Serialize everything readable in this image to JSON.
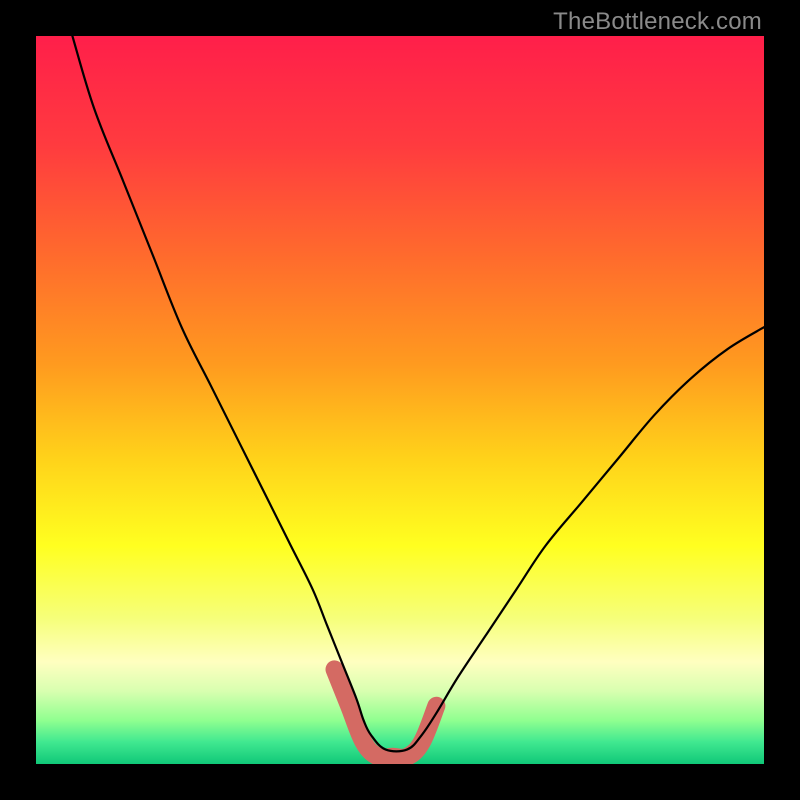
{
  "watermark": "TheBottleneck.com",
  "chart_data": {
    "type": "line",
    "title": "",
    "xlabel": "",
    "ylabel": "",
    "xlim": [
      0,
      100
    ],
    "ylim": [
      0,
      100
    ],
    "series": [
      {
        "name": "bottleneck-curve",
        "x": [
          5,
          8,
          12,
          16,
          20,
          24,
          28,
          32,
          35,
          38,
          40,
          42,
          44,
          45,
          46,
          48,
          51,
          53,
          55,
          58,
          62,
          66,
          70,
          75,
          80,
          85,
          90,
          95,
          100
        ],
        "y": [
          100,
          90,
          80,
          70,
          60,
          52,
          44,
          36,
          30,
          24,
          19,
          14,
          9,
          6,
          4,
          2,
          2,
          4,
          7,
          12,
          18,
          24,
          30,
          36,
          42,
          48,
          53,
          57,
          60
        ]
      },
      {
        "name": "highlight-band",
        "x": [
          41,
          43,
          45,
          47,
          49,
          51,
          53,
          55
        ],
        "y": [
          13,
          8,
          3,
          1,
          1,
          1,
          3,
          8
        ]
      }
    ],
    "gradient_stops": [
      {
        "pos": 0.0,
        "color": "#ff1f4a"
      },
      {
        "pos": 0.15,
        "color": "#ff3b3f"
      },
      {
        "pos": 0.3,
        "color": "#ff6a2d"
      },
      {
        "pos": 0.45,
        "color": "#ff9a1f"
      },
      {
        "pos": 0.58,
        "color": "#ffd21a"
      },
      {
        "pos": 0.7,
        "color": "#ffff20"
      },
      {
        "pos": 0.8,
        "color": "#f6ff7a"
      },
      {
        "pos": 0.86,
        "color": "#ffffc0"
      },
      {
        "pos": 0.9,
        "color": "#d8ffb0"
      },
      {
        "pos": 0.94,
        "color": "#90ff90"
      },
      {
        "pos": 0.97,
        "color": "#40e890"
      },
      {
        "pos": 1.0,
        "color": "#10c878"
      }
    ],
    "highlight_color": "#d46a63",
    "curve_color": "#000000"
  }
}
